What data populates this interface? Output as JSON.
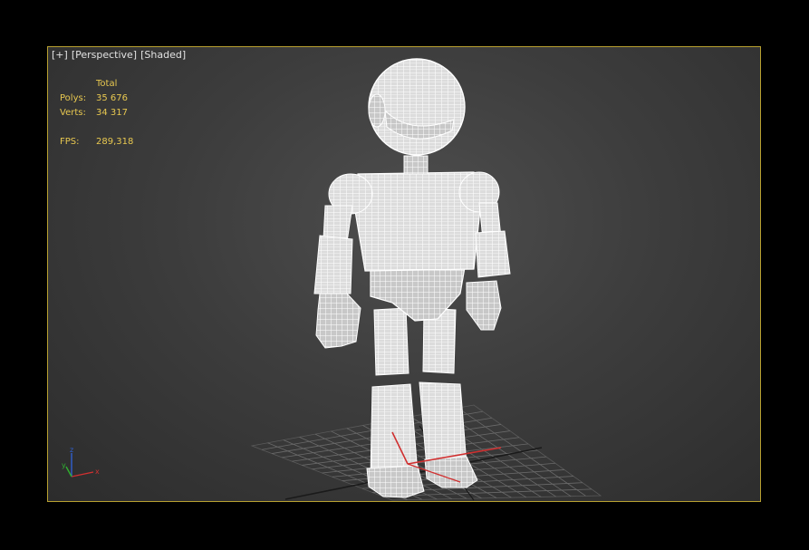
{
  "viewport": {
    "menu_label": "[+]",
    "pov_label": "[Perspective]",
    "shading_label": "[Shaded]"
  },
  "stats": {
    "header": "Total",
    "polys_label": "Polys:",
    "polys_value": "35 676",
    "verts_label": "Verts:",
    "verts_value": "34 317",
    "fps_label": "FPS:",
    "fps_value": "289,318"
  },
  "gizmo": {
    "x_label": "x",
    "y_label": "y",
    "z_label": "z"
  },
  "colors": {
    "viewport_border": "#b8a030",
    "stats_text": "#e8c850",
    "axis_x": "#d03030",
    "axis_y": "#30b030",
    "axis_z": "#3060d0"
  }
}
